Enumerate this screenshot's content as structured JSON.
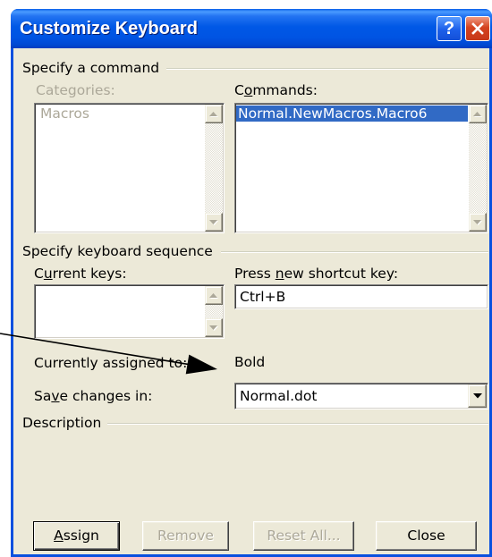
{
  "window": {
    "title": "Customize Keyboard",
    "help_glyph": "?"
  },
  "icons": {
    "help": "help-icon",
    "close": "close-icon",
    "scroll_up": "scroll-up-icon",
    "scroll_down": "scroll-down-icon",
    "dropdown": "chevron-down-icon",
    "annotation": "arrow-icon"
  },
  "colors": {
    "frame": "#0A50DF",
    "title_bar": "#0054E3",
    "dialog_background": "#ECE9D8",
    "selection": "#316AC5",
    "close_button": "#D4431F",
    "disabled_text": "#ACA899",
    "annotation_arrow": "#000000"
  },
  "specify_command": {
    "group_label": "Specify a command",
    "categories_label": "Categories:",
    "categories_enabled": false,
    "categories": [
      "Macros"
    ],
    "commands_label": {
      "before": "C",
      "key": "o",
      "after": "mmands:"
    },
    "commands": [
      "Normal.NewMacros.Macro6"
    ],
    "selected_command_index": 0
  },
  "keyboard_sequence": {
    "group_label": "Specify keyboard sequence",
    "current_keys_label": {
      "before": "C",
      "key": "u",
      "after": "rrent keys:"
    },
    "current_keys": [],
    "new_shortcut_label": {
      "before": "Press ",
      "key": "n",
      "after": "ew shortcut key:"
    },
    "new_shortcut_value": "Ctrl+B",
    "currently_assigned_label": "Currently assigned to:",
    "currently_assigned_value": "Bold",
    "save_changes_label": {
      "before": "Sa",
      "key": "v",
      "after": "e changes in:"
    },
    "save_changes_value": "Normal.dot"
  },
  "description": {
    "group_label": "Description"
  },
  "buttons": {
    "assign": {
      "key": "A",
      "after": "ssign",
      "enabled": true,
      "default": true
    },
    "remove": {
      "label": "Remove",
      "enabled": false
    },
    "reset_all": {
      "label": "Reset All...",
      "enabled": false
    },
    "close": {
      "label": "Close",
      "enabled": true
    }
  }
}
